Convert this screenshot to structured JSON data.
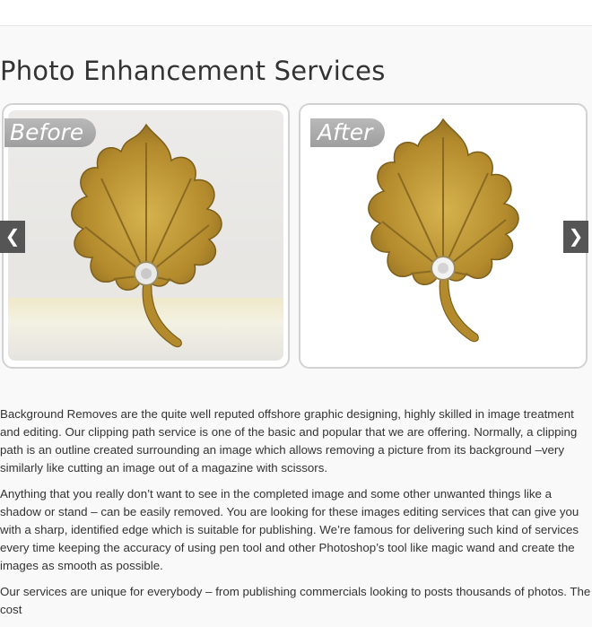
{
  "page": {
    "title": "Photo Enhancement Services"
  },
  "slider": {
    "before_label": "Before",
    "after_label": "After",
    "prev_icon": "chevron-left-icon",
    "next_icon": "chevron-right-icon"
  },
  "content": {
    "paragraphs": [
      "Background Removes are the quite well reputed offshore graphic designing, highly skilled in image treatment and editing. Our clipping path service is one of the basic and popular that we are offering. Normally, a clipping path is an outline created surrounding an image which allows removing a picture from its background –very similarly like cutting an image out of a magazine with scissors.",
      "Anything that you really don’t want to see in the completed image and some other unwanted things like a shadow or stand – can be easily removed. You are looking for these images editing services that can give you with a sharp, identified edge which is suitable for publishing. We’re famous for delivering such kind of services every time keeping the accuracy of using pen tool and other Photoshop’s tool like magic wand and create the images as smooth as possible.",
      "Our services are unique for everybody – from publishing commercials looking to posts thousands of photos. The cost"
    ]
  },
  "colors": {
    "page_bg": "#f9f9f9",
    "ribbon": "#a9a9a9",
    "arrow_bg": "#555555",
    "leaf_gold": "#b8902e"
  }
}
